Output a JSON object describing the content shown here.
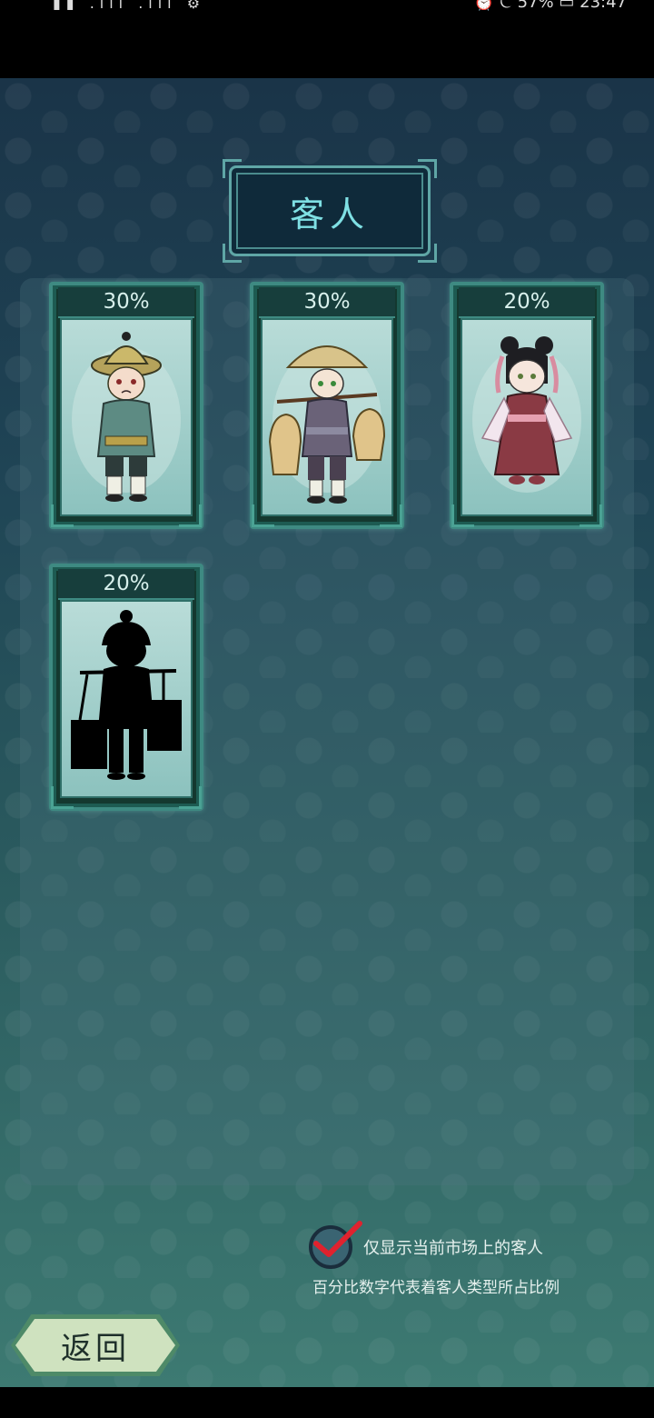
{
  "status_bar": {
    "left": "▮▮ .ııl .ııl ⚙",
    "right": "⏰ ⏾ 57% ▭ 23:47"
  },
  "title": "客人",
  "customers": [
    {
      "percent": "30%",
      "icon": "farmer-straw-hat-character",
      "revealed": true
    },
    {
      "percent": "30%",
      "icon": "porter-carrying-baskets-character",
      "revealed": true
    },
    {
      "percent": "20%",
      "icon": "lady-in-pink-hanfu-character",
      "revealed": true
    },
    {
      "percent": "20%",
      "icon": "unknown-silhouette-character",
      "revealed": false
    }
  ],
  "filter": {
    "label": "仅显示当前市场上的客人",
    "checked": true
  },
  "hint": "百分比数字代表着客人类型所占比例",
  "back_label": "返回"
}
